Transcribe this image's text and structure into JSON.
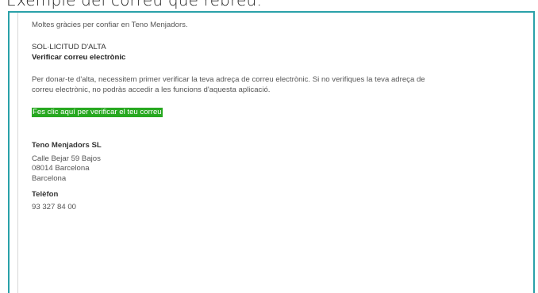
{
  "page_caption": "Exemple del correu que rebreu:",
  "email": {
    "thanks": "Moltes gràcies per confiar en Teno Menjadors.",
    "request_label": "SOL·LICITUD D'ALTA",
    "request_title": "Verificar correu electrònic",
    "body_line1": "Per donar-te d'alta, necessitem primer verificar la teva adreça de correu electrònic. Si no verifiques la teva adreça de",
    "body_line2": "correu electrònic, no podràs accedir a les funcions d'aquesta aplicació.",
    "verify_link": "Fes clic aquí per verificar el teu correu",
    "company_name": "Teno Menjadors SL",
    "address_line1": "Calle Bejar 59 Bajos",
    "address_line2": "08014 Barcelona",
    "address_line3": "Barcelona",
    "phone_label": "Telèfon",
    "phone": "93 327 84 00"
  },
  "colors": {
    "frame_border": "#2aa1a9",
    "link_background": "#27a820",
    "link_text": "#ffffff"
  }
}
